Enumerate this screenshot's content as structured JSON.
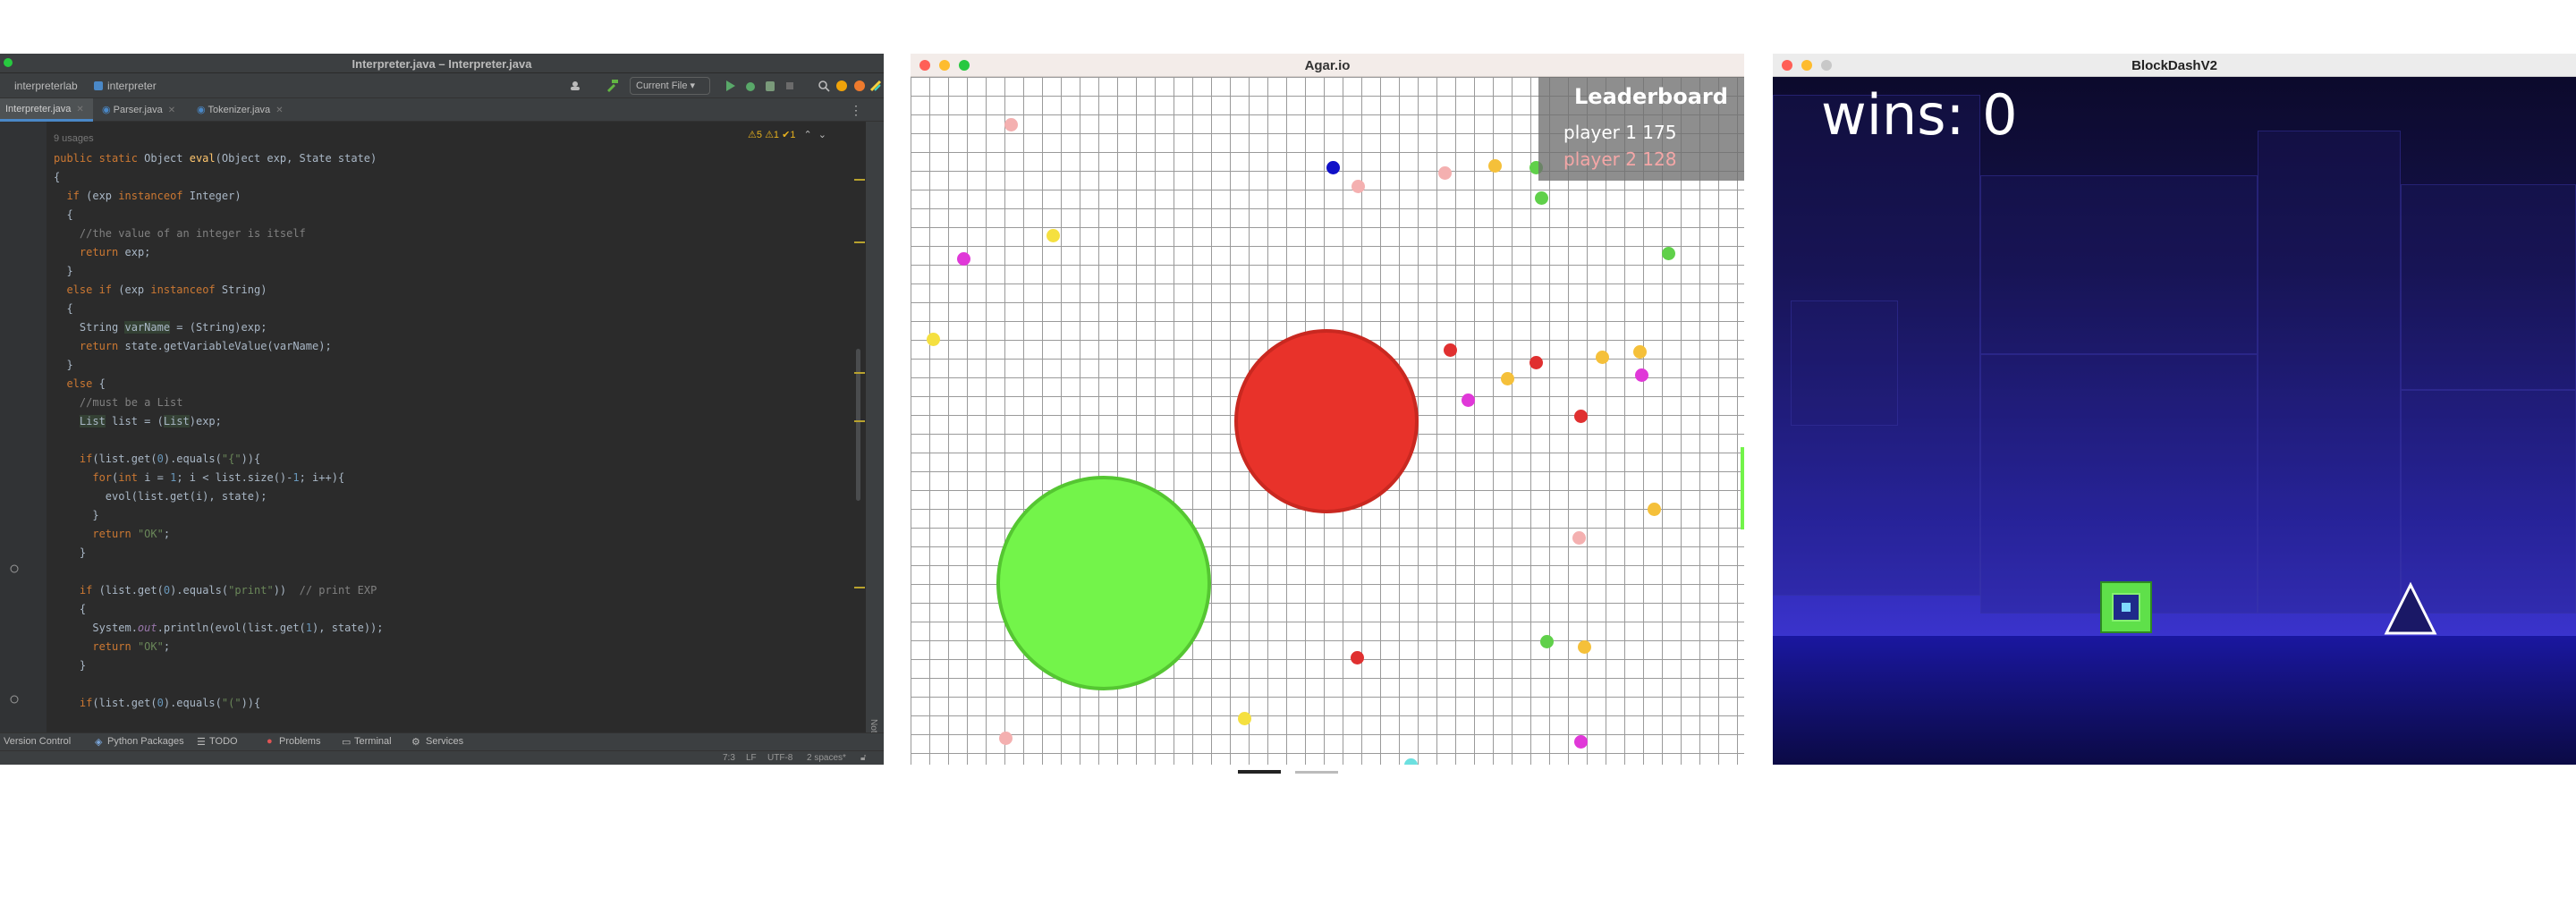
{
  "ide": {
    "title": "Interpreter.java – Interpreter.java",
    "breadcrumbs": [
      "interpreterlab",
      "interpreter"
    ],
    "run_config": "Current File",
    "tabs": [
      {
        "label": "Interpreter.java",
        "active": true
      },
      {
        "label": "Parser.java",
        "active": false
      },
      {
        "label": "Tokenizer.java",
        "active": false
      }
    ],
    "inspections": "⚠5  ⚠1  ✔1",
    "usages_hint": "9 usages",
    "bottom_tools": [
      "Version Control",
      "Python Packages",
      "TODO",
      "Problems",
      "Terminal",
      "Services"
    ],
    "status": {
      "position": "7:3",
      "line_sep": "LF",
      "encoding": "UTF-8",
      "indent": "2 spaces*"
    },
    "notifications_label": "Notifications"
  },
  "agar": {
    "title": "Agar.io",
    "leaderboard": {
      "heading": "Leaderboard",
      "rows": [
        {
          "label": "player 1 175",
          "color": "#ffffff"
        },
        {
          "label": "player 2 128",
          "color": "#f4a6a6"
        }
      ]
    },
    "players": [
      {
        "name": "player 1",
        "color": "#e8322a"
      },
      {
        "name": "player 2",
        "color": "#73f44a"
      }
    ]
  },
  "blockdash": {
    "title": "BlockDashV2",
    "wins_text": "wins: 0",
    "player_color": "#5fe04a",
    "spike_color": "#ffffff"
  }
}
